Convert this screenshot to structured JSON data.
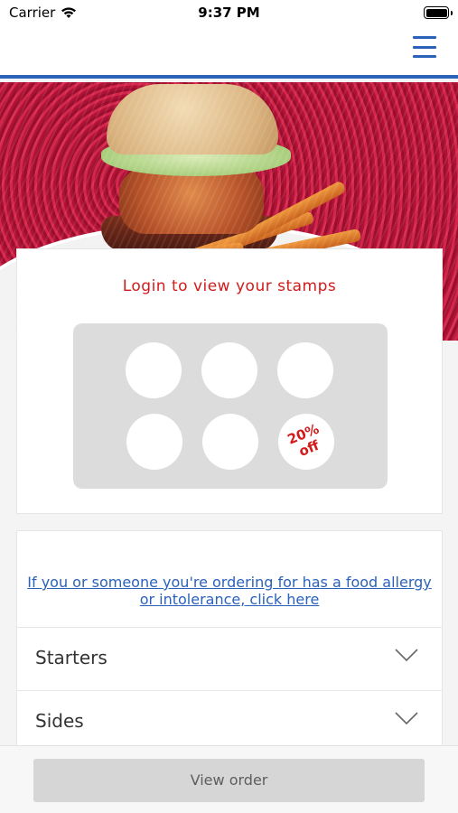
{
  "status_bar": {
    "carrier": "Carrier",
    "time": "9:37 PM"
  },
  "header": {
    "menu_icon": "hamburger-menu-icon",
    "accent_color": "#2a62ba"
  },
  "hero": {
    "image": "burger-and-fries-photo"
  },
  "stamp_card": {
    "title": "Login to view your stamps",
    "stamp_slots": 6,
    "reward_text": "20%\noff",
    "title_color": "#d21b1b"
  },
  "allergy": {
    "link_text": "If you or someone you're ordering for has a food allergy or intolerance, click here"
  },
  "categories": [
    {
      "label": "Starters",
      "icon": "chevron-down-icon"
    },
    {
      "label": "Sides",
      "icon": "chevron-down-icon"
    }
  ],
  "bottom_bar": {
    "button_label": "View order"
  }
}
